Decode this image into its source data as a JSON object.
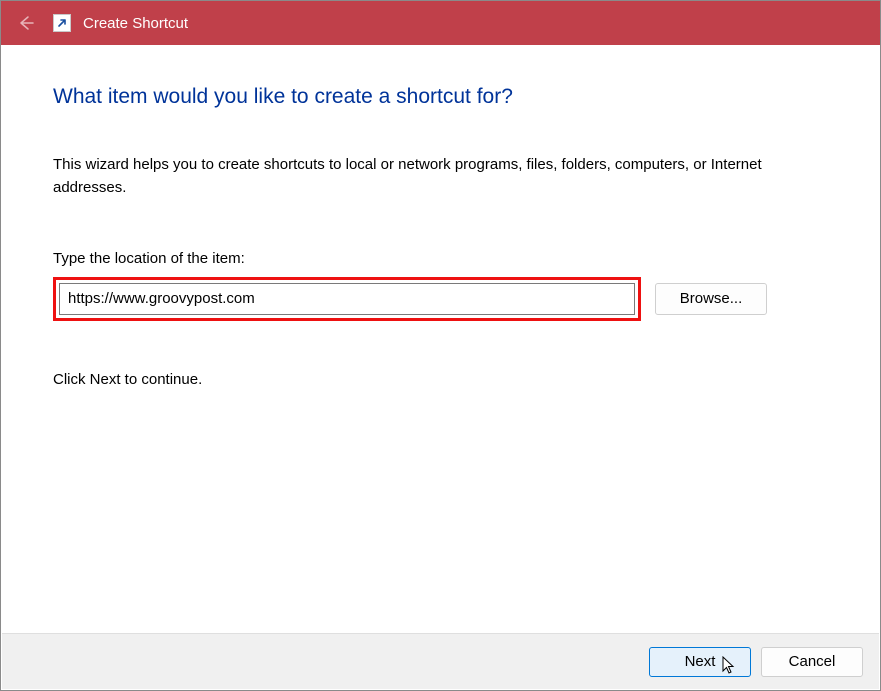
{
  "titlebar": {
    "title": "Create Shortcut"
  },
  "content": {
    "headline": "What item would you like to create a shortcut for?",
    "description": "This wizard helps you to create shortcuts to local or network programs, files, folders, computers, or Internet addresses.",
    "field_label": "Type the location of the item:",
    "location_value": "https://www.groovypost.com",
    "browse_label": "Browse...",
    "continue_text": "Click Next to continue."
  },
  "footer": {
    "next_label": "Next",
    "cancel_label": "Cancel"
  }
}
